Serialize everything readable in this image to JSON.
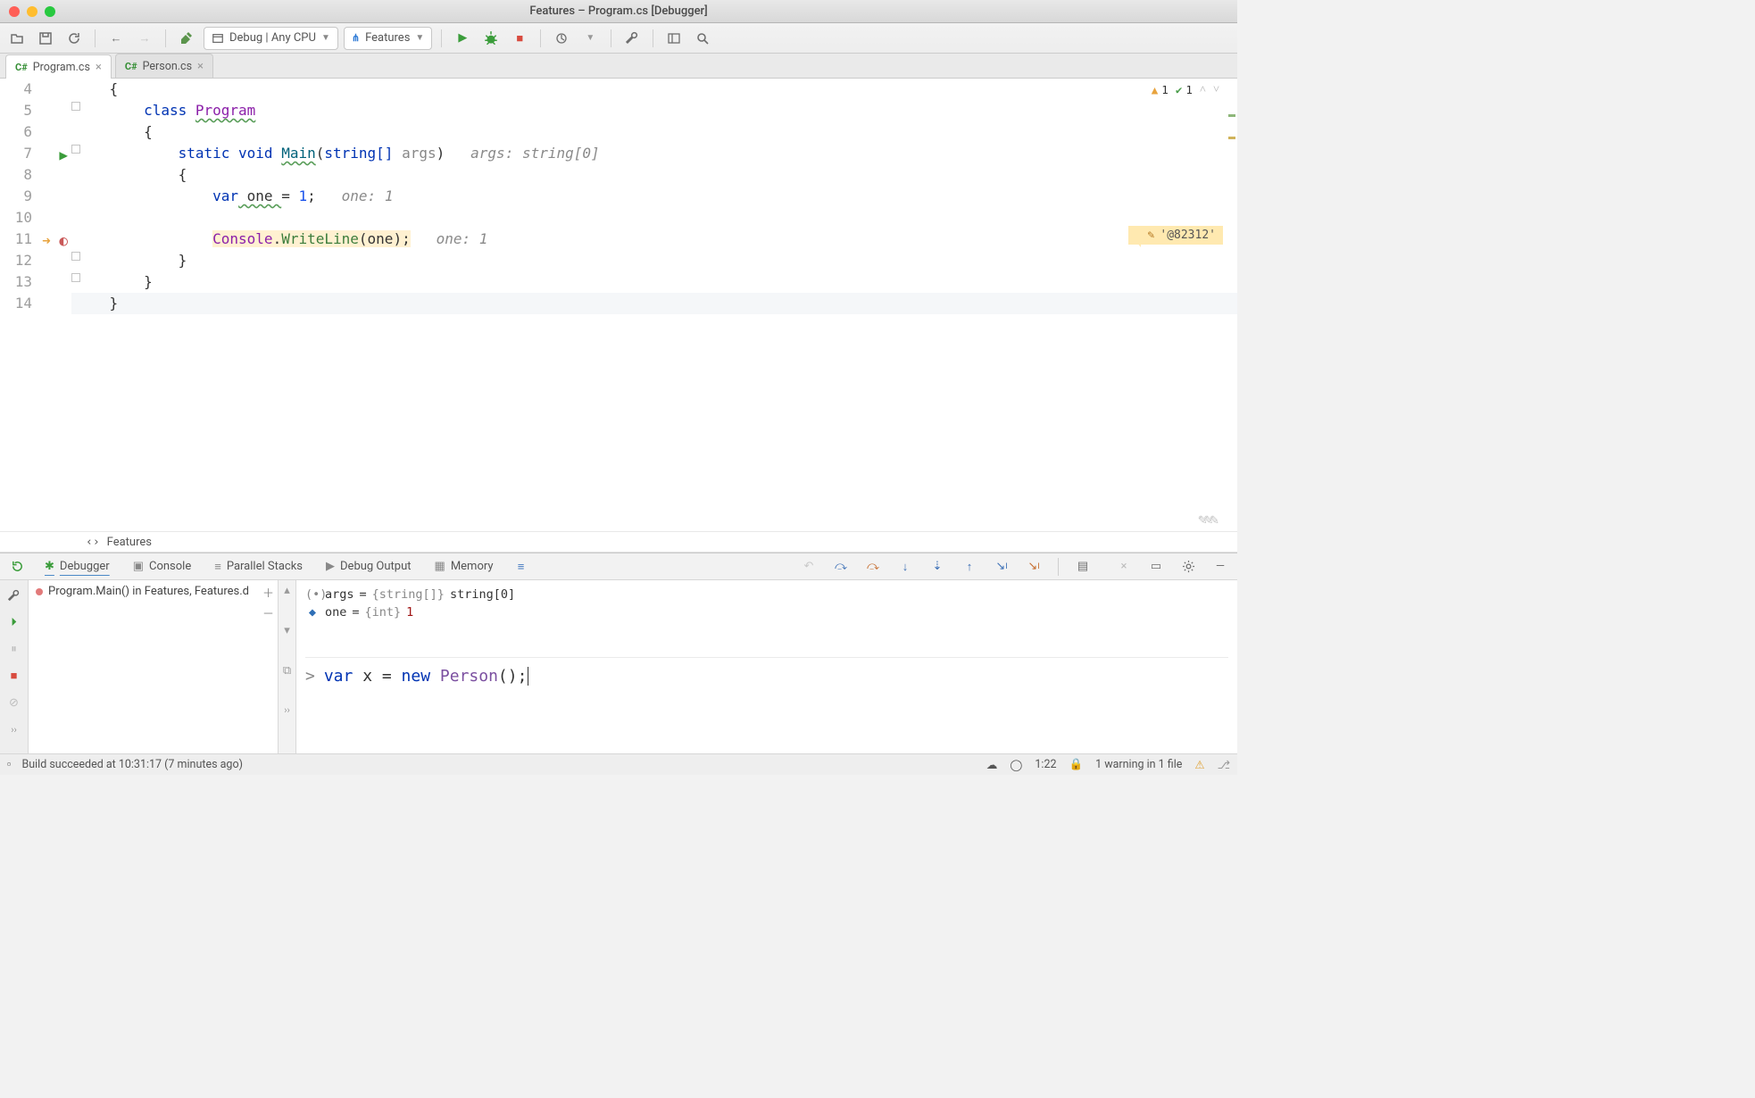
{
  "title": "Features – Program.cs [Debugger]",
  "toolbar": {
    "config": "Debug | Any CPU",
    "project": "Features"
  },
  "tabs": [
    {
      "label": "Program.cs",
      "active": true
    },
    {
      "label": "Person.cs",
      "active": false
    }
  ],
  "inspections": {
    "warnings": "1",
    "passes": "1"
  },
  "gutter": {
    "lines": [
      "4",
      "5",
      "6",
      "7",
      "8",
      "9",
      "10",
      "11",
      "12",
      "13",
      "14"
    ]
  },
  "code": {
    "l4": "{",
    "l5_kw": "class",
    "l5_name": "Program",
    "l6": "{",
    "l7_kw1": "static",
    "l7_kw2": "void",
    "l7_fn": "Main",
    "l7_sig_open": "(",
    "l7_param_type": "string[]",
    "l7_param_name": " args",
    "l7_sig_close": ")",
    "l7_hint": "args: string[0]",
    "l8": "{",
    "l9_kw": "var",
    "l9_name": " one ",
    "l9_rest": "= ",
    "l9_num": "1",
    "l9_semi": ";",
    "l9_hint": "one: 1",
    "l11_recv": "Console",
    "l11_dot": ".",
    "l11_call": "WriteLine",
    "l11_args": "(one);",
    "l11_hint": "one: 1",
    "l12": "}",
    "l13": "}",
    "l14": "}"
  },
  "bookmark": {
    "label": "'@82312'"
  },
  "crumb": "Features",
  "debugger": {
    "tabs": [
      "Debugger",
      "Console",
      "Parallel Stacks",
      "Debug Output",
      "Memory"
    ],
    "frame": "Program.Main() in Features, Features.d",
    "vars": [
      {
        "icon": "param",
        "name": "args",
        "eq": " = ",
        "type": "{string[]}",
        "disp": " string[0]"
      },
      {
        "icon": "local",
        "name": "one",
        "eq": " = ",
        "type": "{int}",
        "disp": " 1"
      }
    ],
    "repl_prompt": ">",
    "repl_kw1": "var",
    "repl_mid": " x = ",
    "repl_kw2": "new",
    "repl_cls": " Person",
    "repl_tail": "();"
  },
  "status": {
    "build": "Build succeeded at 10:31:17 (7 minutes ago)",
    "position": "1:22",
    "warnings": "1 warning in 1 file"
  }
}
